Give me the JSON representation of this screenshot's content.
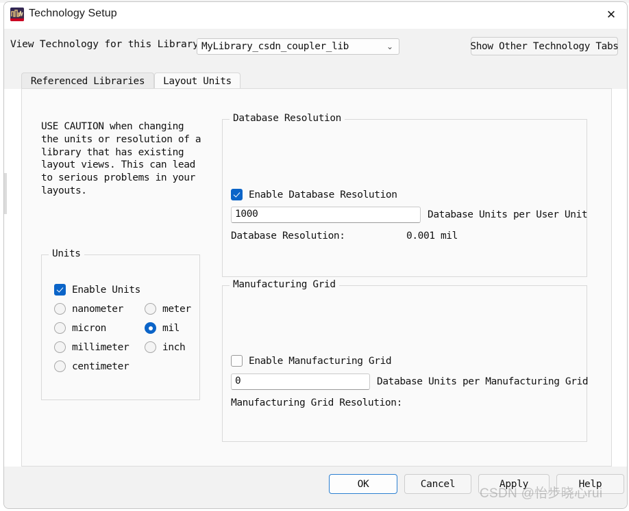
{
  "window": {
    "title": "Technology Setup",
    "icon": "waveform-app-icon",
    "close_label": "✕"
  },
  "toolbar": {
    "library_label": "View Technology for this Library:",
    "library_value": "MyLibrary_csdn_coupler_lib",
    "library_chevron": "⌄",
    "show_other_tabs_label": "Show Other Technology Tabs"
  },
  "tabs": [
    {
      "label": "Referenced Libraries",
      "active": false
    },
    {
      "label": "Layout Units",
      "active": true
    }
  ],
  "panel": {
    "caution_text": "USE CAUTION when changing the units or resolution of a library that has existing layout views. This can lead to serious problems in your layouts."
  },
  "units_group": {
    "legend": "Units",
    "enable_label": "Enable Units",
    "enable_checked": true,
    "options_left": [
      {
        "label": "nanometer",
        "selected": false
      },
      {
        "label": "micron",
        "selected": false
      },
      {
        "label": "millimeter",
        "selected": false
      },
      {
        "label": "centimeter",
        "selected": false
      }
    ],
    "options_right": [
      {
        "label": "meter",
        "selected": false
      },
      {
        "label": "mil",
        "selected": true
      },
      {
        "label": "inch",
        "selected": false
      }
    ]
  },
  "database_resolution_group": {
    "legend": "Database Resolution",
    "enable_label": "Enable Database Resolution",
    "enable_checked": true,
    "input_value": "1000",
    "input_side_label": "Database Units per User Unit",
    "resolution_label": "Database Resolution:",
    "resolution_value": "0.001 mil"
  },
  "manufacturing_grid_group": {
    "legend": "Manufacturing Grid",
    "enable_label": "Enable Manufacturing Grid",
    "enable_checked": false,
    "input_value": "0",
    "input_side_label": "Database Units per Manufacturing Grid",
    "resolution_label": "Manufacturing Grid Resolution:",
    "resolution_value": ""
  },
  "footer": {
    "ok_label": "OK",
    "cancel_label": "Cancel",
    "apply_label": "Apply",
    "help_label": "Help"
  },
  "watermark": "CSDN @怡步晓心rui",
  "colors": {
    "accent_blue": "#0b64c8",
    "focus_border": "#2b7fd1",
    "panel_bg": "#fafafa",
    "chrome_bg": "#f2f2f2"
  }
}
